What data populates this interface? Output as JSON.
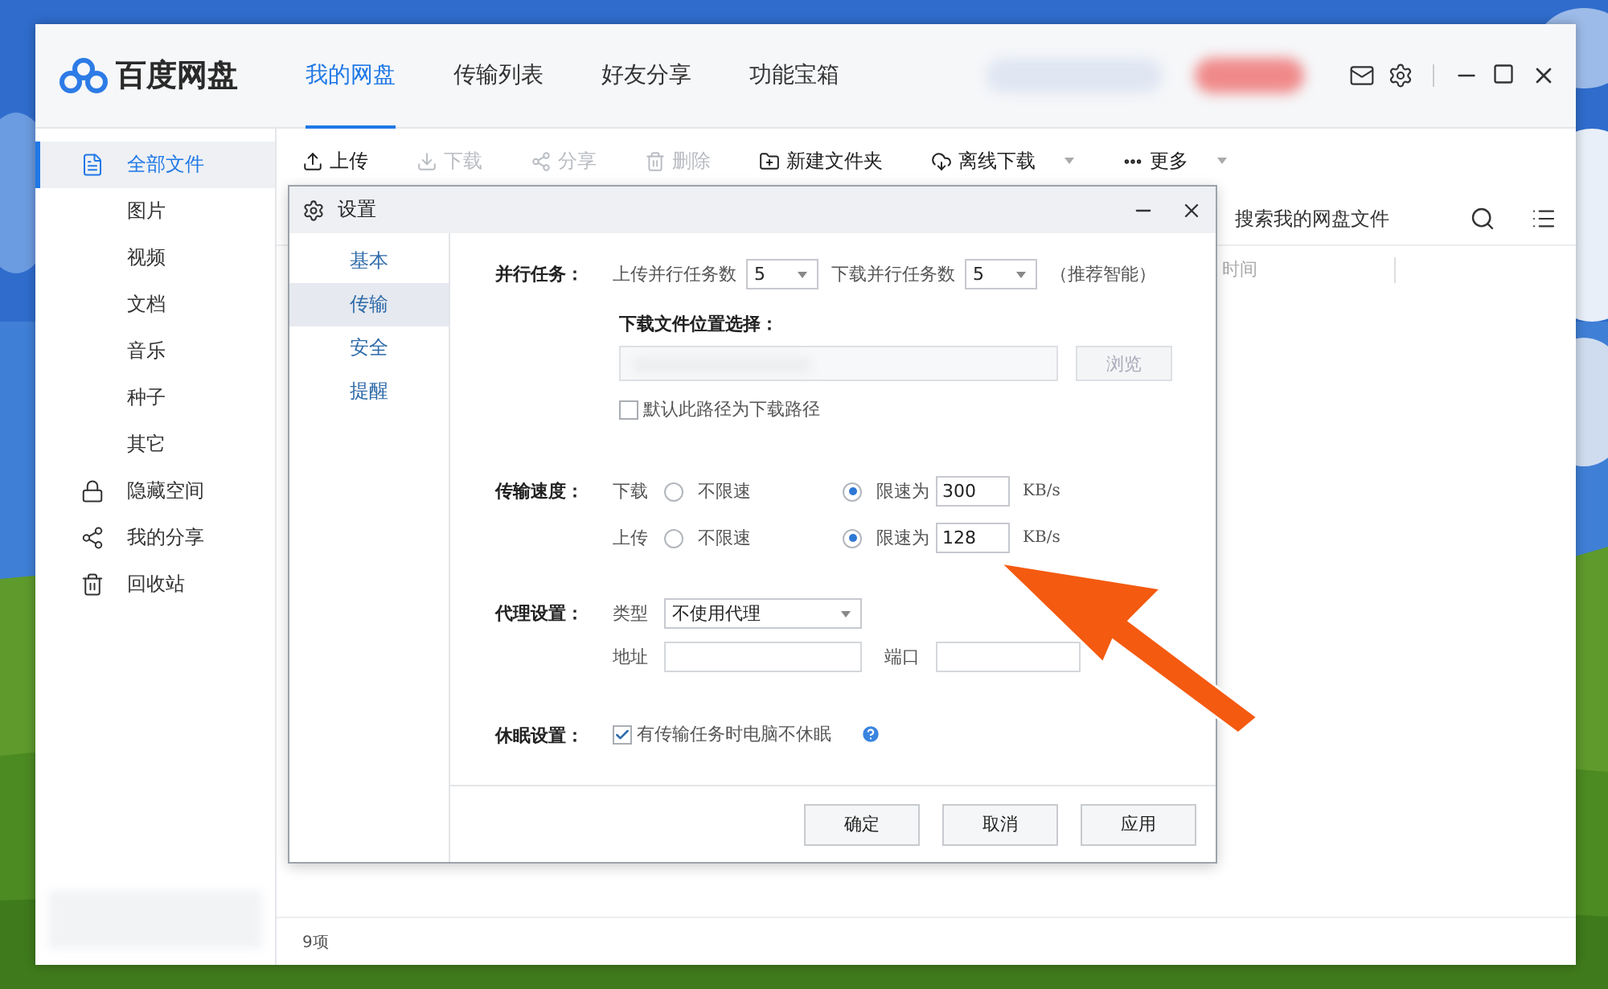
{
  "app": {
    "logo": "百度网盘",
    "tabs": [
      {
        "label": "我的网盘",
        "selected": true
      },
      {
        "label": "传输列表",
        "selected": false
      },
      {
        "label": "好友分享",
        "selected": false
      },
      {
        "label": "功能宝箱",
        "selected": false
      }
    ],
    "sidebar": [
      {
        "label": "全部文件",
        "kind": "file",
        "selected": true,
        "children": [
          {
            "label": "图片",
            "selected": false
          },
          {
            "label": "视频",
            "selected": false
          },
          {
            "label": "文档",
            "selected": false
          },
          {
            "label": "音乐",
            "selected": false
          },
          {
            "label": "种子",
            "selected": false
          },
          {
            "label": "其它",
            "selected": false
          }
        ]
      },
      {
        "label": "隐藏空间",
        "kind": "lock",
        "selected": false
      },
      {
        "label": "我的分享",
        "kind": "share",
        "selected": false
      },
      {
        "label": "回收站",
        "kind": "trash",
        "selected": false
      }
    ],
    "toolbar": [
      {
        "label": "上传",
        "kind": "upload",
        "disabled": false,
        "menu": false
      },
      {
        "label": "下载",
        "kind": "download",
        "disabled": true,
        "menu": false
      },
      {
        "label": "分享",
        "kind": "share",
        "disabled": true,
        "menu": false
      },
      {
        "label": "删除",
        "kind": "trash",
        "disabled": true,
        "menu": false
      },
      {
        "label": "新建文件夹",
        "kind": "folder",
        "disabled": false,
        "menu": false
      },
      {
        "label": "离线下载",
        "kind": "cloud",
        "disabled": false,
        "menu": true
      },
      {
        "label": "更多",
        "kind": "more",
        "disabled": false,
        "menu": true
      }
    ],
    "search": {
      "placeholder": "搜索我的网盘文件"
    },
    "columns": [
      "时间"
    ],
    "status_bar": "9项"
  },
  "dialog": {
    "title": "设置",
    "nav": [
      {
        "label": "基本",
        "selected": false
      },
      {
        "label": "传输",
        "selected": true
      },
      {
        "label": "安全",
        "selected": false
      },
      {
        "label": "提醒",
        "selected": false
      }
    ],
    "parallel": {
      "label": "并行任务：",
      "upload_label": "上传并行任务数",
      "upload_value": "5",
      "download_label": "下载并行任务数",
      "download_value": "5",
      "hint": "（推荐智能）"
    },
    "location": {
      "label": "下载文件位置选择：",
      "browse": "浏览",
      "browse_disabled": true,
      "default_checkbox": {
        "label": "默认此路径为下载路径",
        "checked": false
      }
    },
    "speed": {
      "label": "传输速度：",
      "rows": [
        {
          "label": "下载",
          "options": [
            {
              "label": "不限速",
              "selected": false
            },
            {
              "label": "限速为",
              "selected": true
            }
          ],
          "value": "300",
          "unit": "KB/s"
        },
        {
          "label": "上传",
          "options": [
            {
              "label": "不限速",
              "selected": false
            },
            {
              "label": "限速为",
              "selected": true
            }
          ],
          "value": "128",
          "unit": "KB/s"
        }
      ]
    },
    "proxy": {
      "label": "代理设置：",
      "type_label": "类型",
      "type_value": "不使用代理",
      "address_label": "地址",
      "port_label": "端口"
    },
    "sleep": {
      "label": "休眠设置：",
      "checkbox": {
        "label": "有传输任务时电脑不休眠",
        "checked": true
      }
    },
    "buttons": [
      "确定",
      "取消",
      "应用"
    ]
  }
}
